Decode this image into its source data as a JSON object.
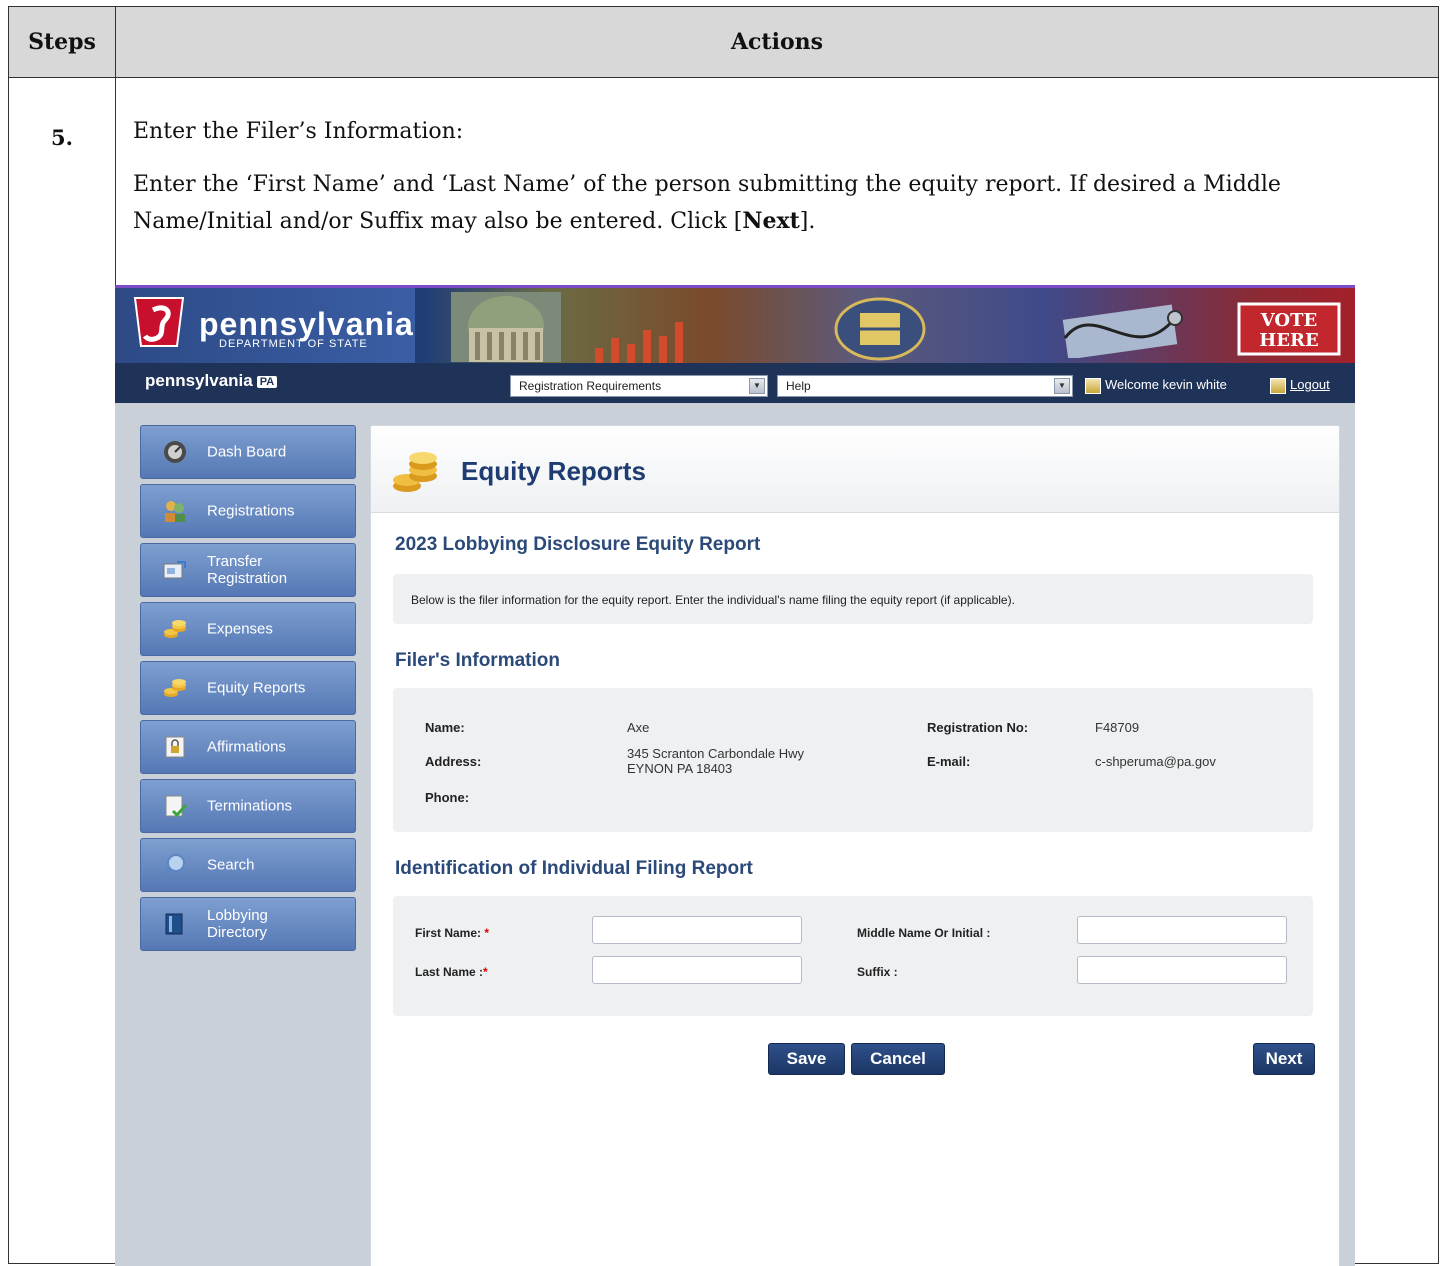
{
  "doc": {
    "header_steps": "Steps",
    "header_actions": "Actions",
    "step_number": "5.",
    "instruction_title": "Enter the Filer’s Information:",
    "instruction_body_1": "Enter the ‘First Name’ and ‘Last Name’ of the person submitting the equity report.  If desired a Middle Name/Initial and/or Suffix may also be entered. Click [",
    "instruction_next": "Next",
    "instruction_body_2": "]."
  },
  "app": {
    "logo_title": "pennsylvania",
    "logo_subtitle": "DEPARTMENT OF STATE",
    "banner_vote_1": "VOTE",
    "banner_vote_2": "HERE",
    "nav_brand": "pennsylvania",
    "nav_brand_badge": "PA",
    "dropdown_registration": "Registration Requirements",
    "dropdown_help": "Help",
    "welcome": "Welcome kevin white",
    "logout": "Logout",
    "sidebar": [
      {
        "label": "Dash Board",
        "icon": "dashboard-icon"
      },
      {
        "label": "Registrations",
        "icon": "users-icon"
      },
      {
        "label": "Transfer Registration",
        "icon": "transfer-icon"
      },
      {
        "label": "Expenses",
        "icon": "coins-icon"
      },
      {
        "label": "Equity Reports",
        "icon": "coins-icon"
      },
      {
        "label": "Affirmations",
        "icon": "document-lock-icon"
      },
      {
        "label": "Terminations",
        "icon": "document-check-icon"
      },
      {
        "label": "Search",
        "icon": "search-icon"
      },
      {
        "label": "Lobbying Directory",
        "icon": "book-icon"
      }
    ],
    "page_title": "Equity Reports",
    "report_title": "2023 Lobbying Disclosure Equity Report",
    "note": "Below is the filer information for the equity report. Enter the individual's name filing the equity report (if applicable).",
    "filer_section": "Filer's Information",
    "filer": {
      "name_label": "Name:",
      "name_value": "Axe",
      "address_label": "Address:",
      "address_line1": "345 Scranton Carbondale Hwy",
      "address_line2": "EYNON PA 18403",
      "phone_label": "Phone:",
      "reg_label": "Registration No:",
      "reg_value": "F48709",
      "email_label": "E-mail:",
      "email_value": "c-shperuma@pa.gov"
    },
    "ident_section": "Identification of Individual Filing Report",
    "ident": {
      "first_label": "First Name:",
      "last_label": "Last Name :",
      "middle_label": "Middle Name Or Initial :",
      "suffix_label": "Suffix :",
      "required_mark": "*",
      "first_value": "",
      "last_value": "",
      "middle_value": "",
      "suffix_value": ""
    },
    "buttons": {
      "save": "Save",
      "cancel": "Cancel",
      "next": "Next"
    }
  }
}
